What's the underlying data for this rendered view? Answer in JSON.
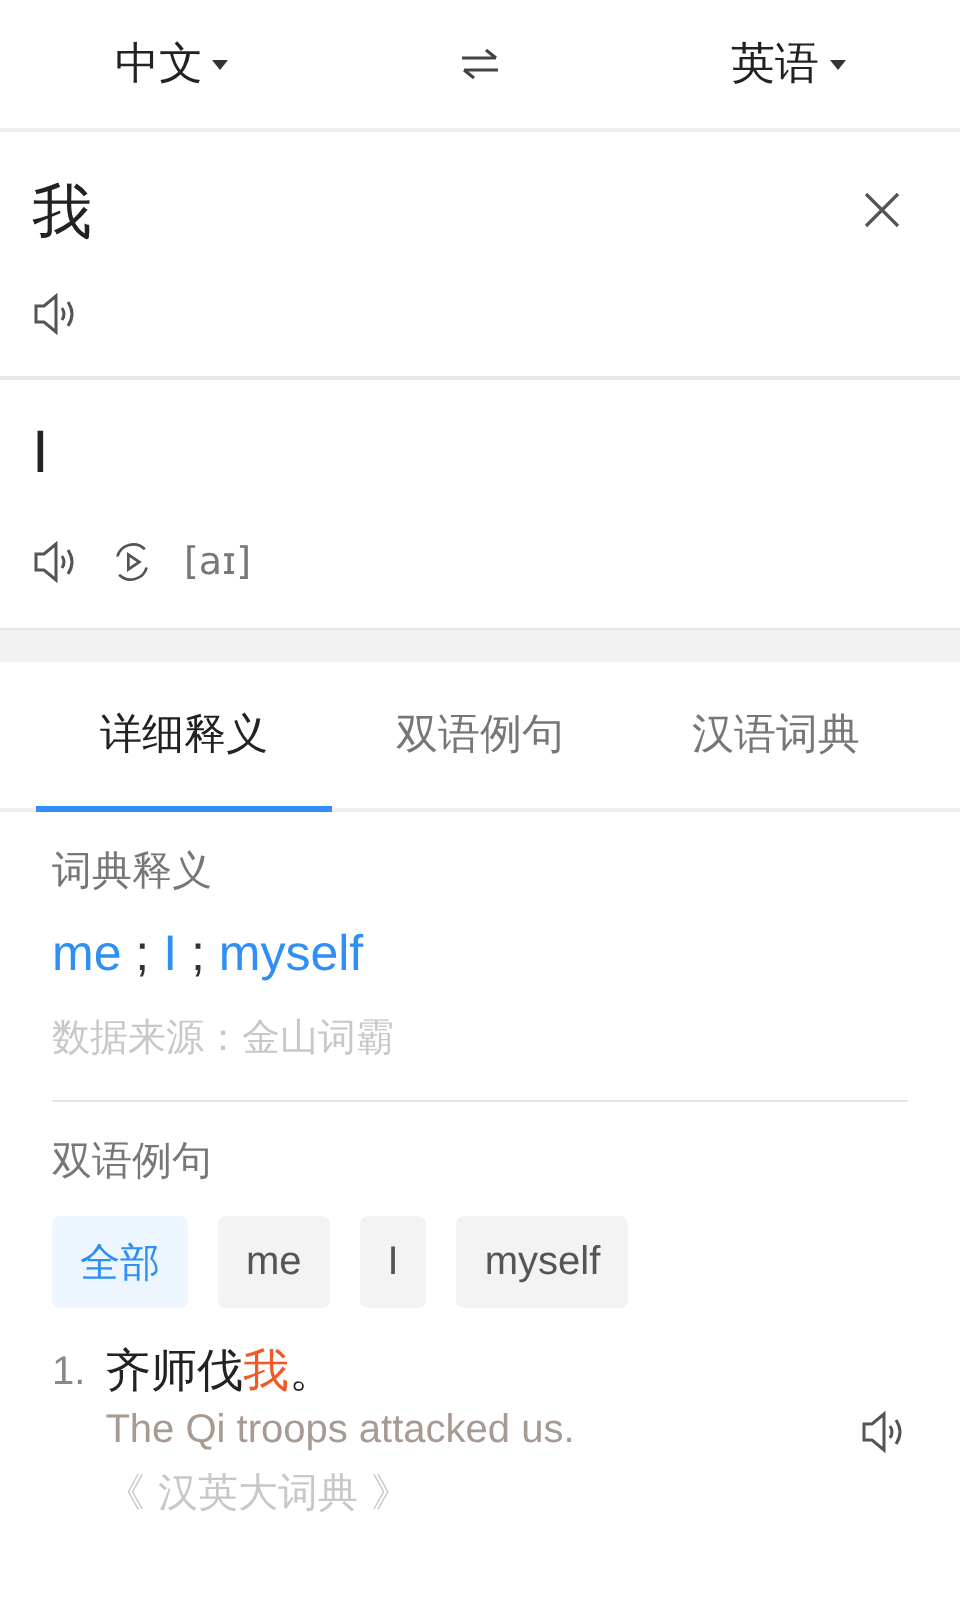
{
  "languages": {
    "source": "中文",
    "target": "英语"
  },
  "input": {
    "value": "我"
  },
  "result": {
    "word": "I",
    "phonetic": "[aɪ]"
  },
  "tabs": [
    {
      "label": "详细释义",
      "selected": true
    },
    {
      "label": "双语例句",
      "selected": false
    },
    {
      "label": "汉语词典",
      "selected": false
    }
  ],
  "dictionary": {
    "heading": "词典释义",
    "definition": [
      {
        "text": "me",
        "link": true
      },
      {
        "text": " ; ",
        "link": false
      },
      {
        "text": "I",
        "link": true
      },
      {
        "text": " ; ",
        "link": false
      },
      {
        "text": "myself",
        "link": true
      }
    ],
    "source": "数据来源：金山词霸"
  },
  "examples": {
    "heading": "双语例句",
    "filters": [
      {
        "label": "全部",
        "selected": true
      },
      {
        "label": "me",
        "selected": false
      },
      {
        "label": "I",
        "selected": false
      },
      {
        "label": "myself",
        "selected": false
      }
    ],
    "items": [
      {
        "number": "1.",
        "sentence": [
          {
            "text": "齐师伐",
            "highlight": false
          },
          {
            "text": "我",
            "highlight": true
          },
          {
            "text": "。",
            "highlight": false
          }
        ],
        "translation": "The Qi troops attacked us.",
        "source": "《 汉英大词典 》"
      }
    ]
  }
}
